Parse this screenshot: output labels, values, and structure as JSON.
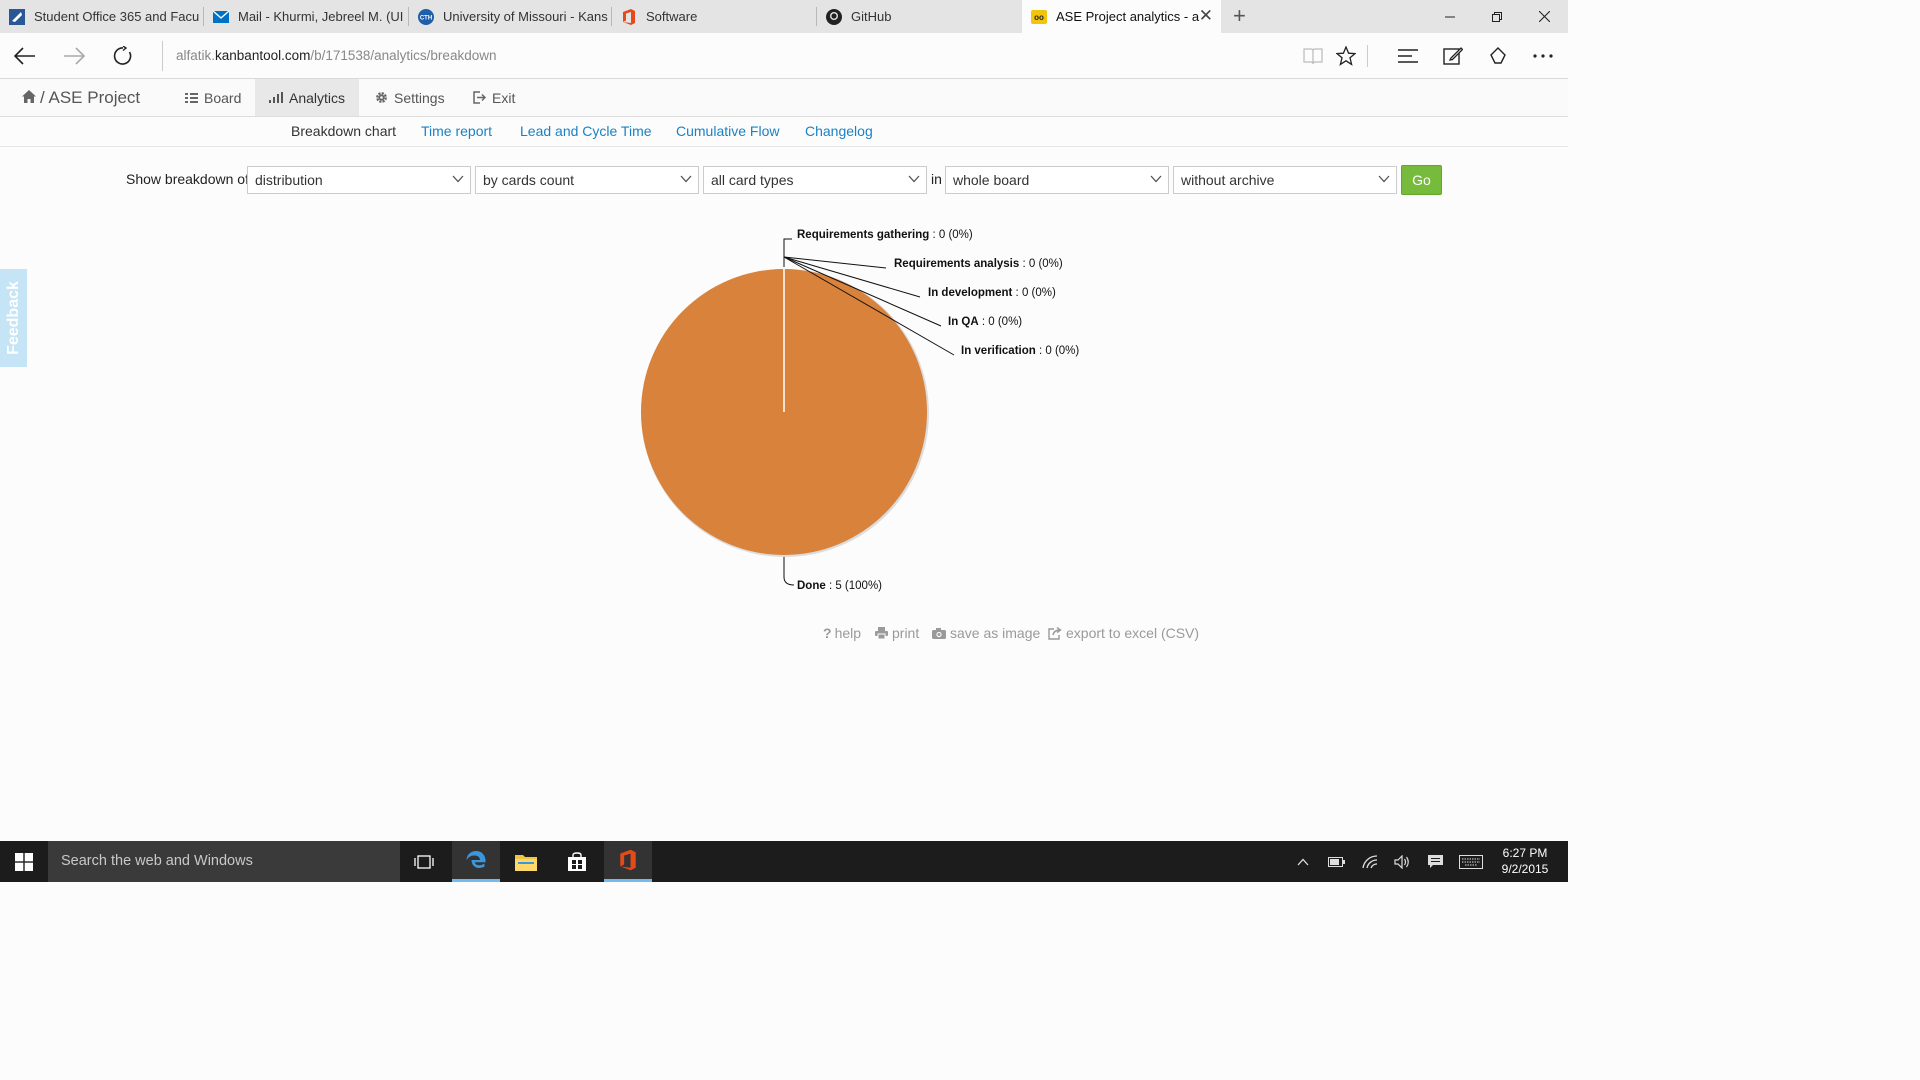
{
  "browser": {
    "tabs": [
      {
        "title": "Student Office 365 and Facu",
        "icon": "office-portal-icon"
      },
      {
        "title": "Mail - Khurmi, Jebreel M. (UI",
        "icon": "mail-icon"
      },
      {
        "title": "University of Missouri - Kans",
        "icon": "umkc-icon"
      },
      {
        "title": "Software",
        "icon": "office-icon"
      },
      {
        "title": "GitHub",
        "icon": "github-icon"
      },
      {
        "title": "ASE Project analytics - a",
        "icon": "kanbantool-icon",
        "active": true
      }
    ],
    "url_prefix": "alfatik.",
    "url_domain": "kanbantool.com",
    "url_path": "/b/171538/analytics/breakdown"
  },
  "app": {
    "project": "/ ASE Project",
    "nav": {
      "board": "Board",
      "analytics": "Analytics",
      "settings": "Settings",
      "exit": "Exit"
    },
    "subnav": {
      "breakdown": "Breakdown chart",
      "time_report": "Time report",
      "lead_cycle": "Lead and Cycle Time",
      "cumulative": "Cumulative Flow",
      "changelog": "Changelog"
    },
    "link_color": "#1a82c4",
    "feedback": "Feedback"
  },
  "filters": {
    "label": "Show breakdown of",
    "in_label": "in",
    "of": "distribution",
    "by": "by cards count",
    "types": "all card types",
    "scope": "whole board",
    "archive": "without archive",
    "go": "Go"
  },
  "chart_data": {
    "type": "pie",
    "slice_color": "#d9823b",
    "slices": [
      {
        "label": "Requirements gathering",
        "value": 0,
        "pct": "0%"
      },
      {
        "label": "Requirements analysis",
        "value": 0,
        "pct": "0%"
      },
      {
        "label": "In development",
        "value": 0,
        "pct": "0%"
      },
      {
        "label": "In QA",
        "value": 0,
        "pct": "0%"
      },
      {
        "label": "In verification",
        "value": 0,
        "pct": "0%"
      },
      {
        "label": "Done",
        "value": 5,
        "pct": "100%"
      }
    ]
  },
  "actions": {
    "help": "help",
    "print": "print",
    "save": "save as image",
    "export": "export to excel (CSV)"
  },
  "taskbar": {
    "search_placeholder": "Search the web and Windows",
    "time": "6:27 PM",
    "date": "9/2/2015"
  }
}
